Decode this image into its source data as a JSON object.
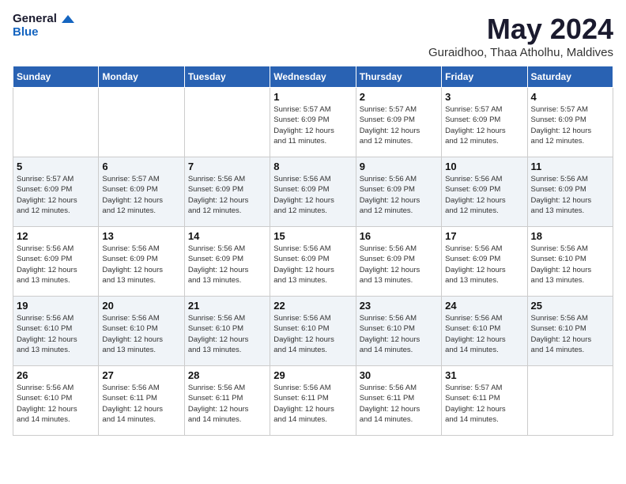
{
  "header": {
    "logo_general": "General",
    "logo_blue": "Blue",
    "month_title": "May 2024",
    "location": "Guraidhoo, Thaa Atholhu, Maldives"
  },
  "weekdays": [
    "Sunday",
    "Monday",
    "Tuesday",
    "Wednesday",
    "Thursday",
    "Friday",
    "Saturday"
  ],
  "weeks": [
    {
      "row_class": "normal",
      "days": [
        {
          "num": "",
          "text": ""
        },
        {
          "num": "",
          "text": ""
        },
        {
          "num": "",
          "text": ""
        },
        {
          "num": "1",
          "text": "Sunrise: 5:57 AM\nSunset: 6:09 PM\nDaylight: 12 hours\nand 11 minutes."
        },
        {
          "num": "2",
          "text": "Sunrise: 5:57 AM\nSunset: 6:09 PM\nDaylight: 12 hours\nand 12 minutes."
        },
        {
          "num": "3",
          "text": "Sunrise: 5:57 AM\nSunset: 6:09 PM\nDaylight: 12 hours\nand 12 minutes."
        },
        {
          "num": "4",
          "text": "Sunrise: 5:57 AM\nSunset: 6:09 PM\nDaylight: 12 hours\nand 12 minutes."
        }
      ]
    },
    {
      "row_class": "alt",
      "days": [
        {
          "num": "5",
          "text": "Sunrise: 5:57 AM\nSunset: 6:09 PM\nDaylight: 12 hours\nand 12 minutes."
        },
        {
          "num": "6",
          "text": "Sunrise: 5:57 AM\nSunset: 6:09 PM\nDaylight: 12 hours\nand 12 minutes."
        },
        {
          "num": "7",
          "text": "Sunrise: 5:56 AM\nSunset: 6:09 PM\nDaylight: 12 hours\nand 12 minutes."
        },
        {
          "num": "8",
          "text": "Sunrise: 5:56 AM\nSunset: 6:09 PM\nDaylight: 12 hours\nand 12 minutes."
        },
        {
          "num": "9",
          "text": "Sunrise: 5:56 AM\nSunset: 6:09 PM\nDaylight: 12 hours\nand 12 minutes."
        },
        {
          "num": "10",
          "text": "Sunrise: 5:56 AM\nSunset: 6:09 PM\nDaylight: 12 hours\nand 12 minutes."
        },
        {
          "num": "11",
          "text": "Sunrise: 5:56 AM\nSunset: 6:09 PM\nDaylight: 12 hours\nand 13 minutes."
        }
      ]
    },
    {
      "row_class": "normal",
      "days": [
        {
          "num": "12",
          "text": "Sunrise: 5:56 AM\nSunset: 6:09 PM\nDaylight: 12 hours\nand 13 minutes."
        },
        {
          "num": "13",
          "text": "Sunrise: 5:56 AM\nSunset: 6:09 PM\nDaylight: 12 hours\nand 13 minutes."
        },
        {
          "num": "14",
          "text": "Sunrise: 5:56 AM\nSunset: 6:09 PM\nDaylight: 12 hours\nand 13 minutes."
        },
        {
          "num": "15",
          "text": "Sunrise: 5:56 AM\nSunset: 6:09 PM\nDaylight: 12 hours\nand 13 minutes."
        },
        {
          "num": "16",
          "text": "Sunrise: 5:56 AM\nSunset: 6:09 PM\nDaylight: 12 hours\nand 13 minutes."
        },
        {
          "num": "17",
          "text": "Sunrise: 5:56 AM\nSunset: 6:09 PM\nDaylight: 12 hours\nand 13 minutes."
        },
        {
          "num": "18",
          "text": "Sunrise: 5:56 AM\nSunset: 6:10 PM\nDaylight: 12 hours\nand 13 minutes."
        }
      ]
    },
    {
      "row_class": "alt",
      "days": [
        {
          "num": "19",
          "text": "Sunrise: 5:56 AM\nSunset: 6:10 PM\nDaylight: 12 hours\nand 13 minutes."
        },
        {
          "num": "20",
          "text": "Sunrise: 5:56 AM\nSunset: 6:10 PM\nDaylight: 12 hours\nand 13 minutes."
        },
        {
          "num": "21",
          "text": "Sunrise: 5:56 AM\nSunset: 6:10 PM\nDaylight: 12 hours\nand 13 minutes."
        },
        {
          "num": "22",
          "text": "Sunrise: 5:56 AM\nSunset: 6:10 PM\nDaylight: 12 hours\nand 14 minutes."
        },
        {
          "num": "23",
          "text": "Sunrise: 5:56 AM\nSunset: 6:10 PM\nDaylight: 12 hours\nand 14 minutes."
        },
        {
          "num": "24",
          "text": "Sunrise: 5:56 AM\nSunset: 6:10 PM\nDaylight: 12 hours\nand 14 minutes."
        },
        {
          "num": "25",
          "text": "Sunrise: 5:56 AM\nSunset: 6:10 PM\nDaylight: 12 hours\nand 14 minutes."
        }
      ]
    },
    {
      "row_class": "normal",
      "days": [
        {
          "num": "26",
          "text": "Sunrise: 5:56 AM\nSunset: 6:10 PM\nDaylight: 12 hours\nand 14 minutes."
        },
        {
          "num": "27",
          "text": "Sunrise: 5:56 AM\nSunset: 6:11 PM\nDaylight: 12 hours\nand 14 minutes."
        },
        {
          "num": "28",
          "text": "Sunrise: 5:56 AM\nSunset: 6:11 PM\nDaylight: 12 hours\nand 14 minutes."
        },
        {
          "num": "29",
          "text": "Sunrise: 5:56 AM\nSunset: 6:11 PM\nDaylight: 12 hours\nand 14 minutes."
        },
        {
          "num": "30",
          "text": "Sunrise: 5:56 AM\nSunset: 6:11 PM\nDaylight: 12 hours\nand 14 minutes."
        },
        {
          "num": "31",
          "text": "Sunrise: 5:57 AM\nSunset: 6:11 PM\nDaylight: 12 hours\nand 14 minutes."
        },
        {
          "num": "",
          "text": ""
        }
      ]
    }
  ]
}
